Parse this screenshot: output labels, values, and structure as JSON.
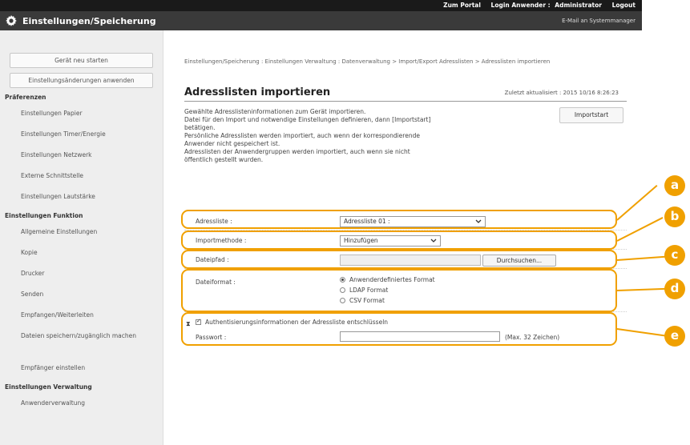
{
  "topbar": {
    "portal": "Zum Portal",
    "login": "Login Anwender :",
    "user": "Administrator",
    "logout": "Logout"
  },
  "header": {
    "title": "Einstellungen/Speicherung",
    "mail_link": "E-Mail an Systemmanager",
    "icon": "gear-icon"
  },
  "sidebar": {
    "buttons": [
      "Gerät neu starten",
      "Einstellungsänderungen anwenden"
    ],
    "sections": [
      {
        "title": "Präferenzen",
        "items": [
          "Einstellungen Papier",
          "Einstellungen Timer/Energie",
          "Einstellungen Netzwerk",
          "Externe Schnittstelle",
          "Einstellungen Lautstärke"
        ]
      },
      {
        "title": "Einstellungen Funktion",
        "items": [
          "Allgemeine Einstellungen",
          "Kopie",
          "Drucker",
          "Senden",
          "Empfangen/Weiterleiten",
          "Dateien speichern/zugänglich machen",
          "Empfänger einstellen"
        ]
      },
      {
        "title": "Einstellungen Verwaltung",
        "items": [
          "Anwenderverwaltung"
        ]
      }
    ]
  },
  "main": {
    "breadcrumb": "Einstellungen/Speicherung : Einstellungen Verwaltung : Datenverwaltung > Import/Export Adresslisten > Adresslisten importieren",
    "title": "Adresslisten importieren",
    "updated": "Zuletzt aktualisiert : 2015 10/16 8:26:23",
    "import_button": "Importstart",
    "description": [
      "Gewählte Adresslisteninformationen zum Gerät importieren.",
      "Datei für den Import und notwendige Einstellungen definieren, dann [Importstart]",
      "betätigen.",
      "Persönliche Adresslisten werden importiert, auch wenn der korrespondierende",
      "Anwender nicht gespeichert ist.",
      "Adresslisten der Anwendergruppen werden importiert, auch wenn sie nicht",
      "öffentlich gestellt wurden."
    ],
    "address_list": {
      "label": "Adressliste :",
      "value": "Adressliste 01 :"
    },
    "import_method": {
      "label": "Importmethode :",
      "value": "Hinzufügen"
    },
    "file_path": {
      "label": "Dateipfad :",
      "browse": "Durchsuchen..."
    },
    "file_format": {
      "label": "Dateiformat :",
      "options": [
        "Anwenderdefiniertes Format",
        "LDAP Format",
        "CSV Format"
      ],
      "selected": 0
    },
    "decrypt": {
      "label": "Authentisierungsinformationen der Adressliste entschlüsseln",
      "checked": true
    },
    "password": {
      "label": "Passwort :",
      "hint": "(Max. 32 Zeichen)"
    }
  },
  "callouts": [
    "a",
    "b",
    "c",
    "d",
    "e"
  ],
  "accent_color": "#f0a000"
}
